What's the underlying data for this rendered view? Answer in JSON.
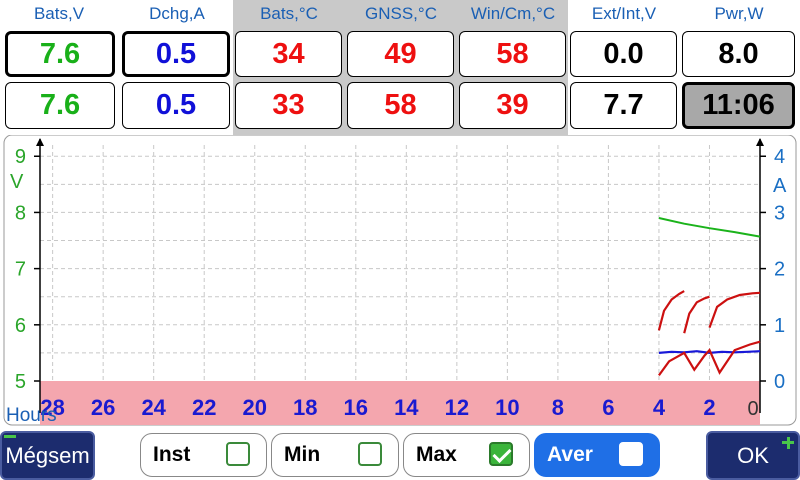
{
  "headers": [
    "Bats,V",
    "Dchg,A",
    "Bats,°C",
    "GNSS,°C",
    "Win/Cm,°C",
    "Ext/Int,V",
    "Pwr,W"
  ],
  "row1": [
    "7.6",
    "0.5",
    "34",
    "49",
    "58",
    "0.0",
    "8.0"
  ],
  "row2": [
    "7.6",
    "0.5",
    "33",
    "58",
    "39",
    "7.7",
    "11:06"
  ],
  "chart_data": {
    "type": "line",
    "xlabel": "Hours",
    "x_ticks": [
      28,
      26,
      24,
      22,
      20,
      18,
      16,
      14,
      12,
      10,
      8,
      6,
      4,
      2,
      0
    ],
    "xlim": [
      28.5,
      0
    ],
    "left_axis": {
      "label": "V",
      "ticks": [
        5,
        6,
        7,
        8,
        9
      ],
      "ylim": [
        5,
        9.2
      ]
    },
    "right_axis": {
      "label": "A",
      "ticks": [
        0,
        1,
        2,
        3,
        4
      ],
      "ylim": [
        0,
        4.2
      ]
    },
    "grid": true,
    "series": [
      {
        "axis": "left",
        "color": "#1bb31b",
        "x": [
          4,
          3,
          2,
          1,
          0
        ],
        "y": [
          7.9,
          7.8,
          7.72,
          7.65,
          7.57
        ]
      },
      {
        "axis": "right",
        "color": "#1818d8",
        "x": [
          4,
          3.5,
          3,
          2.5,
          2,
          1.5,
          1,
          0.5,
          0
        ],
        "y": [
          0.5,
          0.52,
          0.51,
          0.53,
          0.5,
          0.52,
          0.51,
          0.52,
          0.53
        ]
      },
      {
        "axis": "right",
        "color": "#cc1010",
        "x": [
          4,
          3.8,
          3.5,
          3.2,
          3
        ],
        "y": [
          0.9,
          1.25,
          1.45,
          1.55,
          1.6
        ]
      },
      {
        "axis": "right",
        "color": "#cc1010",
        "x": [
          3,
          2.8,
          2.5,
          2.2,
          2
        ],
        "y": [
          0.85,
          1.2,
          1.4,
          1.47,
          1.5
        ]
      },
      {
        "axis": "right",
        "color": "#cc1010",
        "x": [
          2,
          1.7,
          1.3,
          0.8,
          0.3,
          0
        ],
        "y": [
          0.95,
          1.32,
          1.45,
          1.53,
          1.56,
          1.57
        ]
      },
      {
        "axis": "right",
        "color": "#cc1010",
        "x": [
          4,
          3.6,
          3.2,
          3,
          2.6,
          2.2,
          2,
          1.6,
          1,
          0.4,
          0
        ],
        "y": [
          0.1,
          0.35,
          0.45,
          0.5,
          0.2,
          0.45,
          0.55,
          0.15,
          0.55,
          0.65,
          0.7
        ]
      }
    ]
  },
  "buttons": {
    "cancel": "Mégsem",
    "ok": "OK"
  },
  "toggles": [
    {
      "label": "Inst",
      "checked": false,
      "active": false
    },
    {
      "label": "Min",
      "checked": false,
      "active": false
    },
    {
      "label": "Max",
      "checked": true,
      "active": false
    },
    {
      "label": "Aver",
      "checked": false,
      "active": true
    }
  ]
}
